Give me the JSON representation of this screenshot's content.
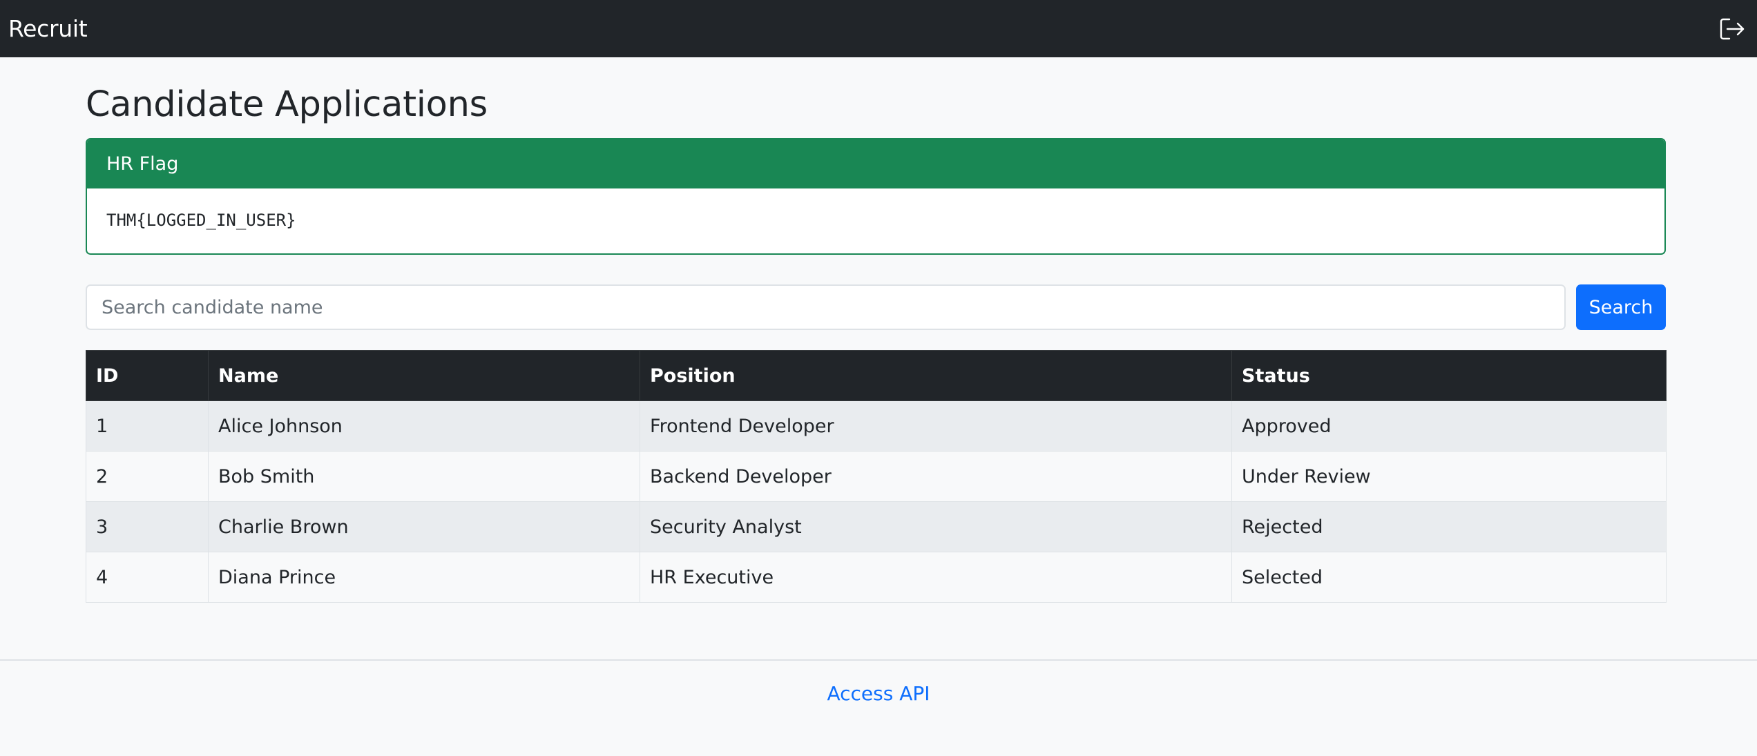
{
  "navbar": {
    "brand": "Recruit",
    "logout_icon": "logout-icon"
  },
  "page": {
    "title": "Candidate Applications"
  },
  "flag_card": {
    "header": "HR Flag",
    "value": "THM{LOGGED_IN_USER}"
  },
  "search": {
    "placeholder": "Search candidate name",
    "value": "",
    "button_label": "Search"
  },
  "table": {
    "headers": {
      "id": "ID",
      "name": "Name",
      "position": "Position",
      "status": "Status"
    },
    "rows": [
      {
        "id": "1",
        "name": "Alice Johnson",
        "position": "Frontend Developer",
        "status": "Approved"
      },
      {
        "id": "2",
        "name": "Bob Smith",
        "position": "Backend Developer",
        "status": "Under Review"
      },
      {
        "id": "3",
        "name": "Charlie Brown",
        "position": "Security Analyst",
        "status": "Rejected"
      },
      {
        "id": "4",
        "name": "Diana Prince",
        "position": "HR Executive",
        "status": "Selected"
      }
    ]
  },
  "footer": {
    "link_label": "Access API"
  },
  "colors": {
    "navbar_bg": "#212529",
    "flag_green": "#198754",
    "primary_blue": "#0d6efd",
    "page_bg": "#f8f9fa"
  }
}
